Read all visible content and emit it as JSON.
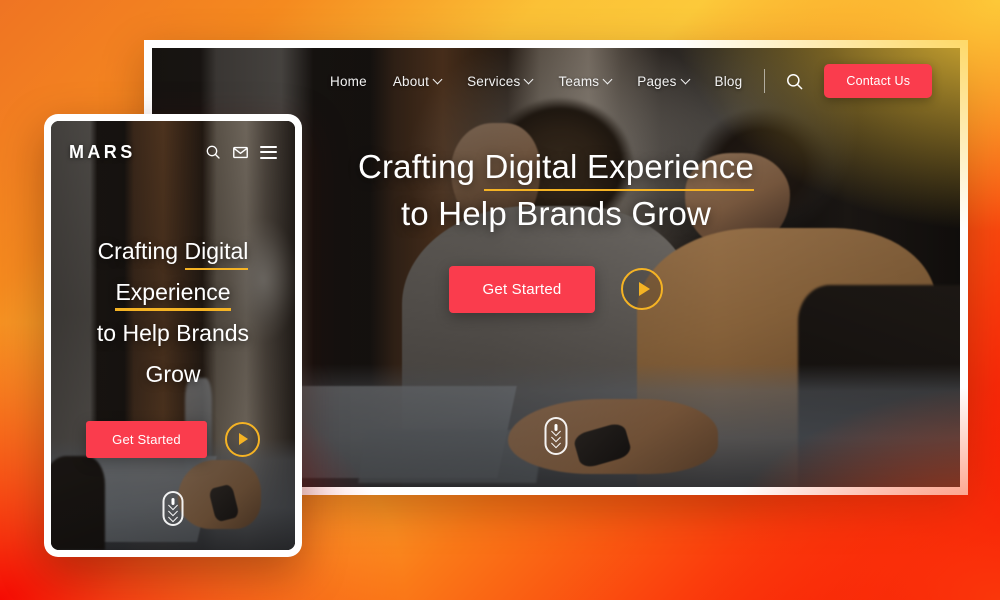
{
  "backdrop": {
    "gradient_colors": [
      "#EF7423",
      "#FCC93A",
      "#FB3D0C",
      "#F50000"
    ]
  },
  "theme": {
    "accent_red": "#FA3C4D",
    "accent_gold": "#F5B324",
    "text_light": "#FFFFFF"
  },
  "desktop": {
    "nav": {
      "links": [
        {
          "label": "Home",
          "has_caret": false
        },
        {
          "label": "About",
          "has_caret": true
        },
        {
          "label": "Services",
          "has_caret": true
        },
        {
          "label": "Teams",
          "has_caret": true
        },
        {
          "label": "Pages",
          "has_caret": true
        },
        {
          "label": "Blog",
          "has_caret": false
        }
      ],
      "search_icon": "search-icon",
      "contact_label": "Contact Us"
    },
    "hero": {
      "line1_prefix": "Crafting ",
      "line1_highlight": "Digital Experience",
      "line2": "to Help Brands Grow",
      "cta_label": "Get Started",
      "play_icon": "play-icon",
      "scroll_icon": "scroll-down-icon"
    },
    "photo_alt": "two men working on laptops in an office"
  },
  "mobile": {
    "nav": {
      "logo": "MARS",
      "search_icon": "search-icon",
      "mail_icon": "mail-icon",
      "menu_icon": "hamburger-menu-icon"
    },
    "hero": {
      "line1_prefix": "Crafting ",
      "line1_highlight": "Digital",
      "line2_highlight": "Experience",
      "line3": "to Help Brands",
      "line4": "Grow",
      "cta_label": "Get Started",
      "play_icon": "play-icon",
      "scroll_icon": "scroll-down-icon"
    },
    "photo_alt": "hands typing on a laptop at a desk"
  }
}
